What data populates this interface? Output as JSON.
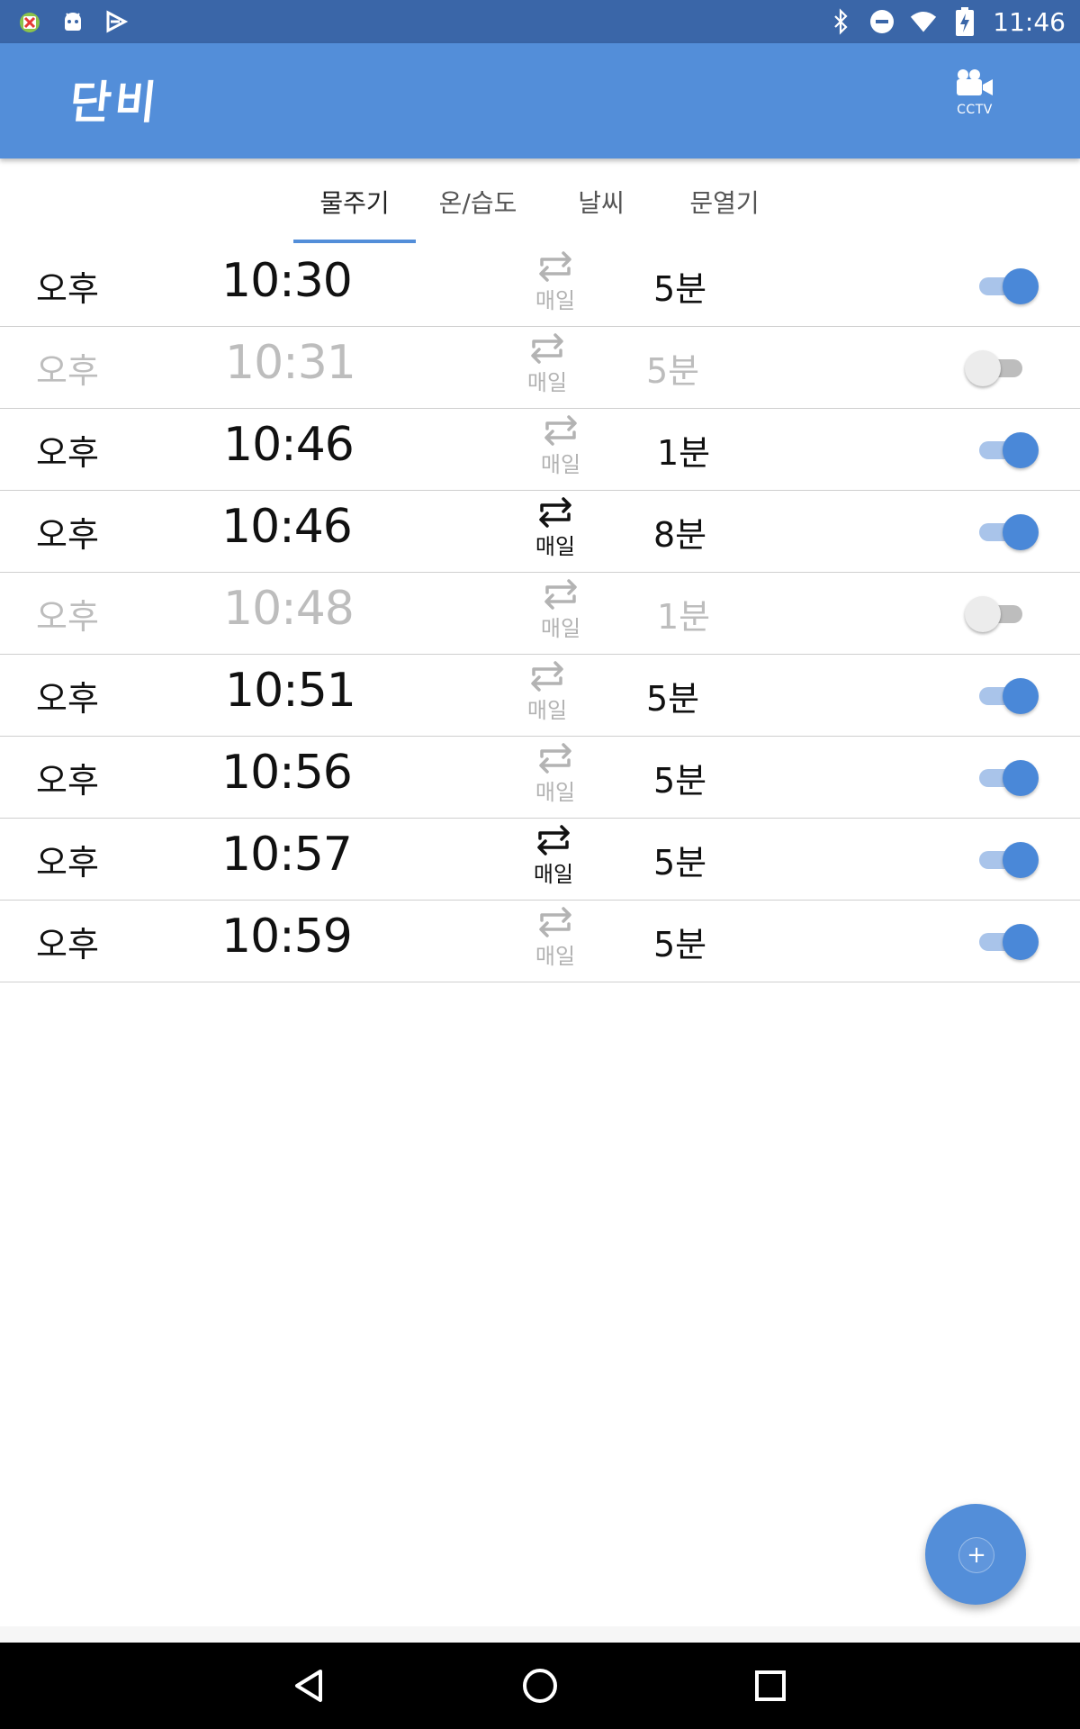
{
  "status_bar": {
    "time": "11:46",
    "left_icons": [
      "android-debug-icon",
      "android-robot-icon",
      "play-store-icon"
    ],
    "right_icons": [
      "bluetooth-icon",
      "do-not-disturb-icon",
      "wifi-icon",
      "battery-charging-icon"
    ]
  },
  "app_bar": {
    "title": "단비",
    "cctv_label": "CCTV",
    "color": "#538ed9"
  },
  "tabs": [
    {
      "label": "물주기",
      "active": true
    },
    {
      "label": "온/습도",
      "active": false
    },
    {
      "label": "날씨",
      "active": false
    },
    {
      "label": "문열기",
      "active": false
    }
  ],
  "alarms": [
    {
      "ampm": "오후",
      "time": "10:30",
      "repeat": "매일",
      "repeat_active": false,
      "duration": "5분",
      "enabled": true
    },
    {
      "ampm": "오후",
      "time": "10:31",
      "repeat": "매일",
      "repeat_active": false,
      "duration": "5분",
      "enabled": false
    },
    {
      "ampm": "오후",
      "time": "10:46",
      "repeat": "매일",
      "repeat_active": false,
      "duration": "1분",
      "enabled": true
    },
    {
      "ampm": "오후",
      "time": "10:46",
      "repeat": "매일",
      "repeat_active": true,
      "duration": "8분",
      "enabled": true
    },
    {
      "ampm": "오후",
      "time": "10:48",
      "repeat": "매일",
      "repeat_active": false,
      "duration": "1분",
      "enabled": false
    },
    {
      "ampm": "오후",
      "time": "10:51",
      "repeat": "매일",
      "repeat_active": false,
      "duration": "5분",
      "enabled": true
    },
    {
      "ampm": "오후",
      "time": "10:56",
      "repeat": "매일",
      "repeat_active": false,
      "duration": "5분",
      "enabled": true
    },
    {
      "ampm": "오후",
      "time": "10:57",
      "repeat": "매일",
      "repeat_active": true,
      "duration": "5분",
      "enabled": true
    },
    {
      "ampm": "오후",
      "time": "10:59",
      "repeat": "매일",
      "repeat_active": false,
      "duration": "5분",
      "enabled": true
    }
  ],
  "fab": {
    "label": "+",
    "icon": "add-icon"
  },
  "nav_bar": {
    "buttons": [
      "back-icon",
      "home-icon",
      "recents-icon"
    ]
  }
}
